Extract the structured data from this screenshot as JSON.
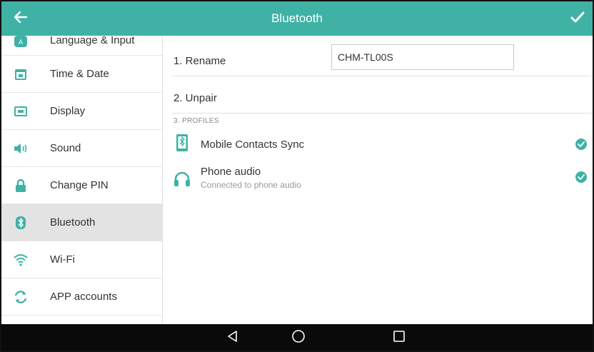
{
  "header": {
    "title": "Bluetooth",
    "back_icon": "arrow-left-icon",
    "confirm_icon": "check-icon",
    "bar_color": "#3fb2a5"
  },
  "sidebar": {
    "items": [
      {
        "label": "Language & Input",
        "icon": "language-icon"
      },
      {
        "label": "Time & Date",
        "icon": "calendar-icon"
      },
      {
        "label": "Display",
        "icon": "display-icon"
      },
      {
        "label": "Sound",
        "icon": "speaker-icon"
      },
      {
        "label": "Change PIN",
        "icon": "lock-icon"
      },
      {
        "label": "Bluetooth",
        "icon": "bluetooth-icon",
        "selected": true
      },
      {
        "label": "Wi-Fi",
        "icon": "wifi-icon"
      },
      {
        "label": "APP accounts",
        "icon": "sync-icon"
      }
    ]
  },
  "content": {
    "rename": {
      "label": "1. Rename",
      "value": "CHM-TL00S"
    },
    "unpair": {
      "label": "2. Unpair"
    },
    "profiles_header": "3. PROFILES",
    "profiles": [
      {
        "name": "Mobile Contacts Sync",
        "subtitle": "",
        "icon": "phone-sync-icon",
        "checked": true
      },
      {
        "name": "Phone audio",
        "subtitle": "Connected to phone audio",
        "icon": "headset-icon",
        "checked": true
      }
    ]
  },
  "navbar": {
    "back": "nav-back-icon",
    "home": "nav-home-icon",
    "recents": "nav-recents-icon"
  }
}
